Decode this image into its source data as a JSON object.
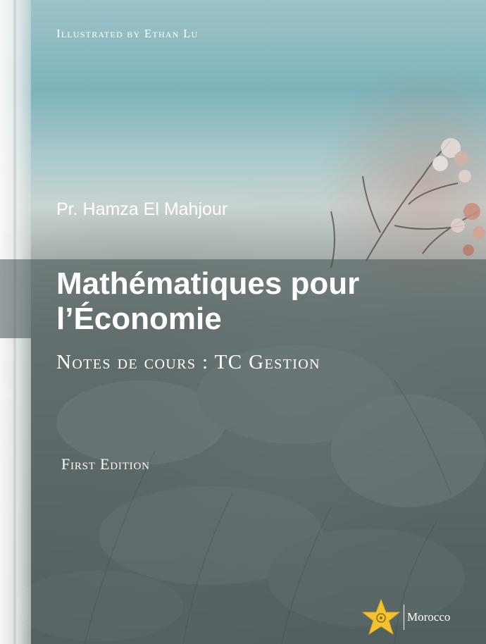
{
  "cover": {
    "illustrator_line": "Illustrated by Ethan Lu",
    "author": "Pr. Hamza El Mahjour",
    "title_line1": "Mathématiques pour",
    "title_line2": "l’Économie",
    "subtitle": "Notes de cours : TC Gestion",
    "edition": "First Edition",
    "publisher": "Morocco"
  },
  "colors": {
    "sky": "#7fb3bb",
    "panel": "#465254",
    "text": "#ffffff",
    "star": "#f2c230"
  },
  "icons": {
    "publisher_logo": "star-logo-icon"
  }
}
